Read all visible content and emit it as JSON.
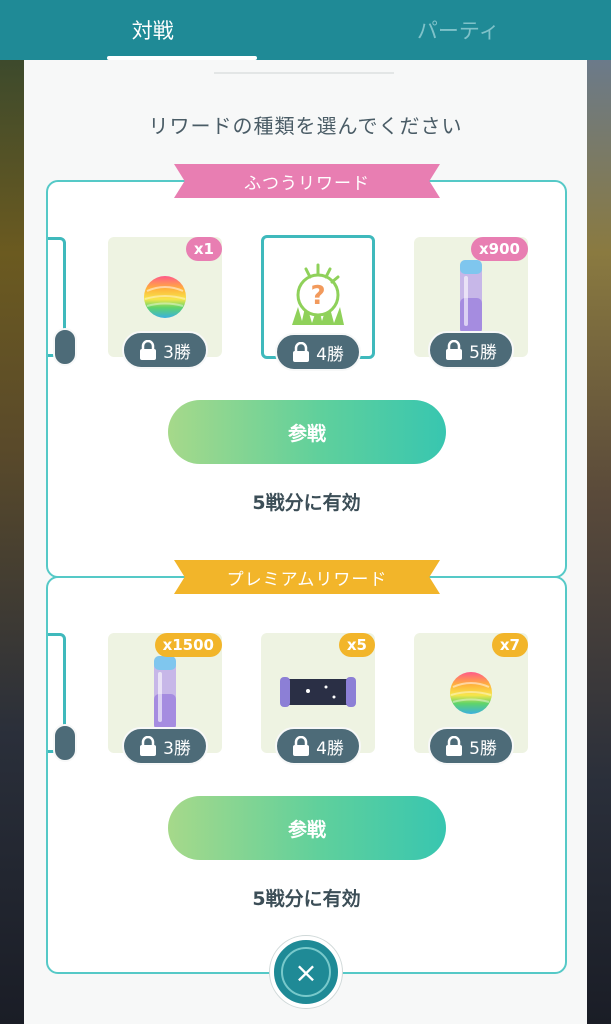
{
  "tabs": [
    {
      "label": "対戦",
      "active": true
    },
    {
      "label": "パーティ",
      "active": false
    }
  ],
  "heading": "リワードの種類を選んでください",
  "normal": {
    "ribbon": "ふつうリワード",
    "cards": [
      {
        "item": "rainbow-candy-icon",
        "count": "x1",
        "wins": "3勝",
        "selected": false
      },
      {
        "item": "mystery-encounter-icon",
        "count": "",
        "wins": "4勝",
        "selected": true
      },
      {
        "item": "stardust-icon",
        "count": "x900",
        "wins": "5勝",
        "selected": false
      }
    ],
    "join_label": "参戦",
    "valid_text": "5戦分に有効"
  },
  "premium": {
    "ribbon": "プレミアムリワード",
    "cards": [
      {
        "item": "stardust-icon",
        "count": "x1500",
        "wins": "3勝"
      },
      {
        "item": "tm-scroll-icon",
        "count": "x5",
        "wins": "4勝"
      },
      {
        "item": "rainbow-candy-icon",
        "count": "x7",
        "wins": "5勝"
      }
    ],
    "join_label": "参戦",
    "valid_text": "5戦分に有効"
  },
  "close_label": "×",
  "colors": {
    "teal": "#1f8a96",
    "panel_border": "#55c9c7",
    "pink_ribbon": "#e87eb2",
    "gold_ribbon": "#f2b52a",
    "pill": "#4d6b78"
  }
}
